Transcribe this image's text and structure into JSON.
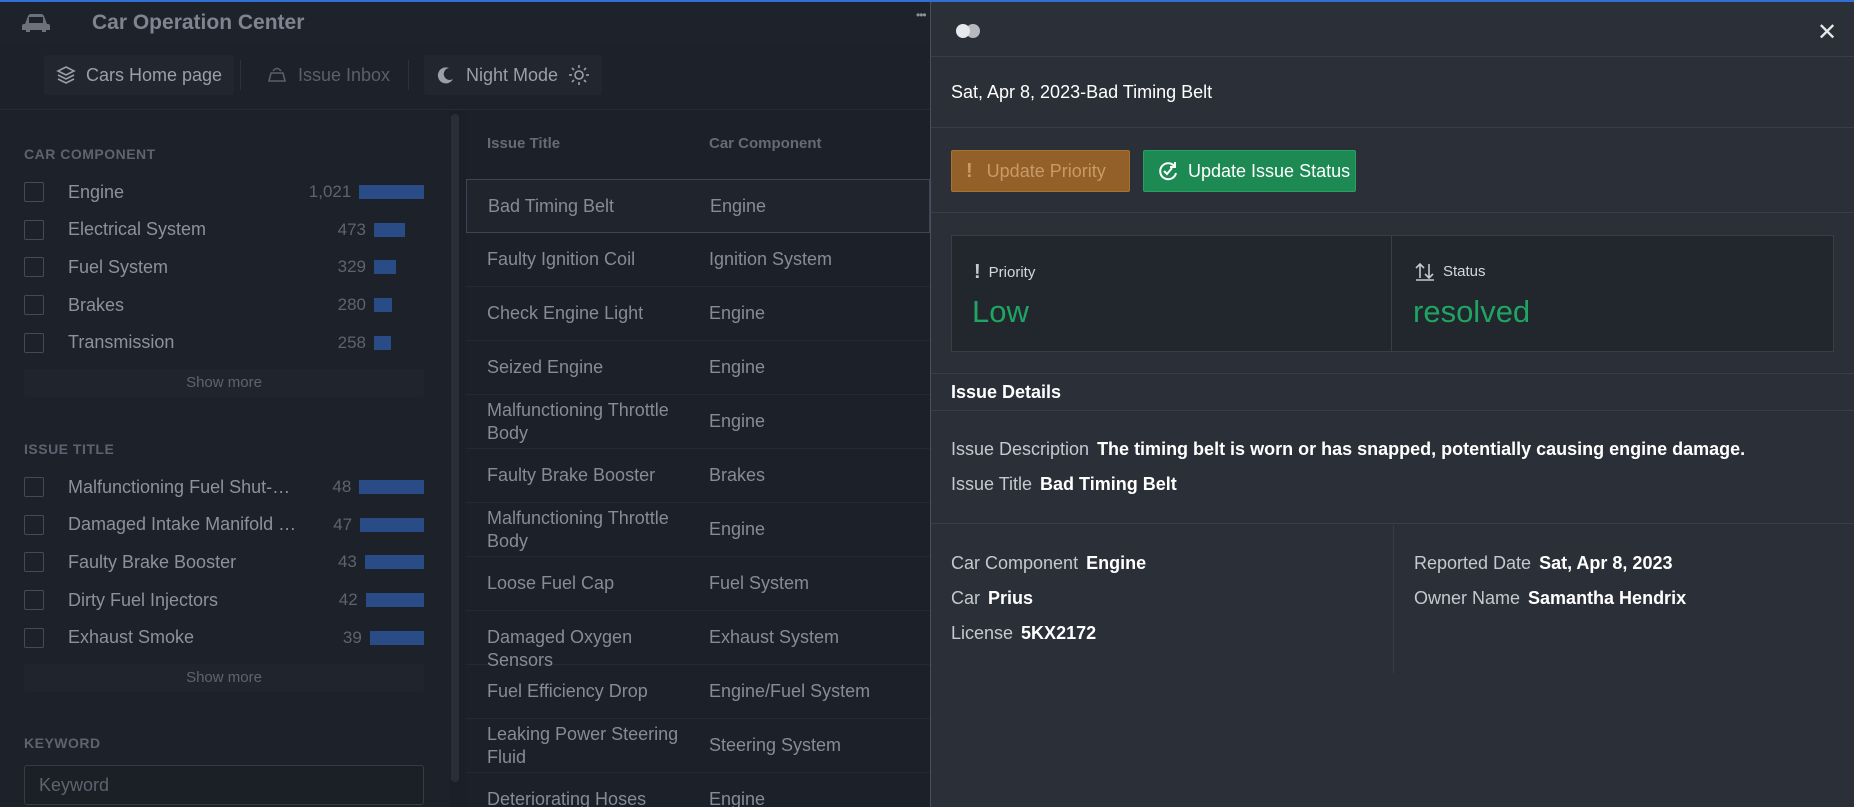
{
  "app": {
    "title": "Car Operation Center",
    "toolbar": {
      "home_label": "Cars Home page",
      "inbox_label": "Issue Inbox",
      "night_label": "Night Mode"
    }
  },
  "sidebar": {
    "component_section": "CAR COMPONENT",
    "components": [
      {
        "label": "Engine",
        "count": "1,021",
        "fraction": 1.0
      },
      {
        "label": "Electrical System",
        "count": "473",
        "fraction": 0.46
      },
      {
        "label": "Fuel System",
        "count": "329",
        "fraction": 0.32
      },
      {
        "label": "Brakes",
        "count": "280",
        "fraction": 0.27
      },
      {
        "label": "Transmission",
        "count": "258",
        "fraction": 0.25
      }
    ],
    "show_more": "Show more",
    "title_section": "ISSUE TITLE",
    "titles": [
      {
        "label": "Malfunctioning Fuel Shut-Off...",
        "count": "48",
        "fraction": 1.0
      },
      {
        "label": "Damaged Intake Manifold Ga...",
        "count": "47",
        "fraction": 0.98
      },
      {
        "label": "Faulty Brake Booster",
        "count": "43",
        "fraction": 0.9
      },
      {
        "label": "Dirty Fuel Injectors",
        "count": "42",
        "fraction": 0.88
      },
      {
        "label": "Exhaust Smoke",
        "count": "39",
        "fraction": 0.81
      }
    ],
    "keyword_section": "KEYWORD",
    "keyword_placeholder": "Keyword"
  },
  "table": {
    "headers": [
      "Issue Title",
      "Car Component"
    ],
    "rows": [
      {
        "title": "Bad Timing Belt",
        "component": "Engine"
      },
      {
        "title": "Faulty Ignition Coil",
        "component": "Ignition System"
      },
      {
        "title": "Check Engine Light",
        "component": "Engine"
      },
      {
        "title": "Seized Engine",
        "component": "Engine"
      },
      {
        "title": "Malfunctioning Throttle Body",
        "component": "Engine"
      },
      {
        "title": "Faulty Brake Booster",
        "component": "Brakes"
      },
      {
        "title": "Malfunctioning Throttle Body",
        "component": "Engine"
      },
      {
        "title": "Loose Fuel Cap",
        "component": "Fuel System"
      },
      {
        "title": "Damaged Oxygen Sensors",
        "component": "Exhaust System"
      },
      {
        "title": "Fuel Efficiency Drop",
        "component": "Engine/Fuel System"
      },
      {
        "title": "Leaking Power Steering Fluid",
        "component": "Steering System"
      },
      {
        "title": "Deteriorating Hoses",
        "component": "Engine"
      }
    ]
  },
  "panel": {
    "heading": "Sat, Apr 8, 2023-Bad Timing Belt",
    "update_priority_label": "Update Priority",
    "update_status_label": "Update Issue Status",
    "priority_label": "Priority",
    "priority_value": "Low",
    "status_label": "Status",
    "status_value": "resolved",
    "details_title": "Issue Details",
    "issue_description_key": "Issue Description",
    "issue_description_value": "The timing belt is worn or has snapped, potentially causing engine damage.",
    "issue_title_key": "Issue Title",
    "issue_title_value": "Bad Timing Belt",
    "car_component_key": "Car Component",
    "car_component_value": "Engine",
    "car_key": "Car",
    "car_value": "Prius",
    "license_key": "License",
    "license_value": "5KX2172",
    "reported_date_key": "Reported Date",
    "reported_date_value": "Sat, Apr 8, 2023",
    "owner_name_key": "Owner Name",
    "owner_name_value": "Samantha Hendrix",
    "close_symbol": "✕"
  },
  "colors": {
    "accent_blue": "#2f6fd6",
    "priority_orange": "#93602a",
    "status_green": "#1d8a53",
    "value_green": "#1fa463"
  }
}
